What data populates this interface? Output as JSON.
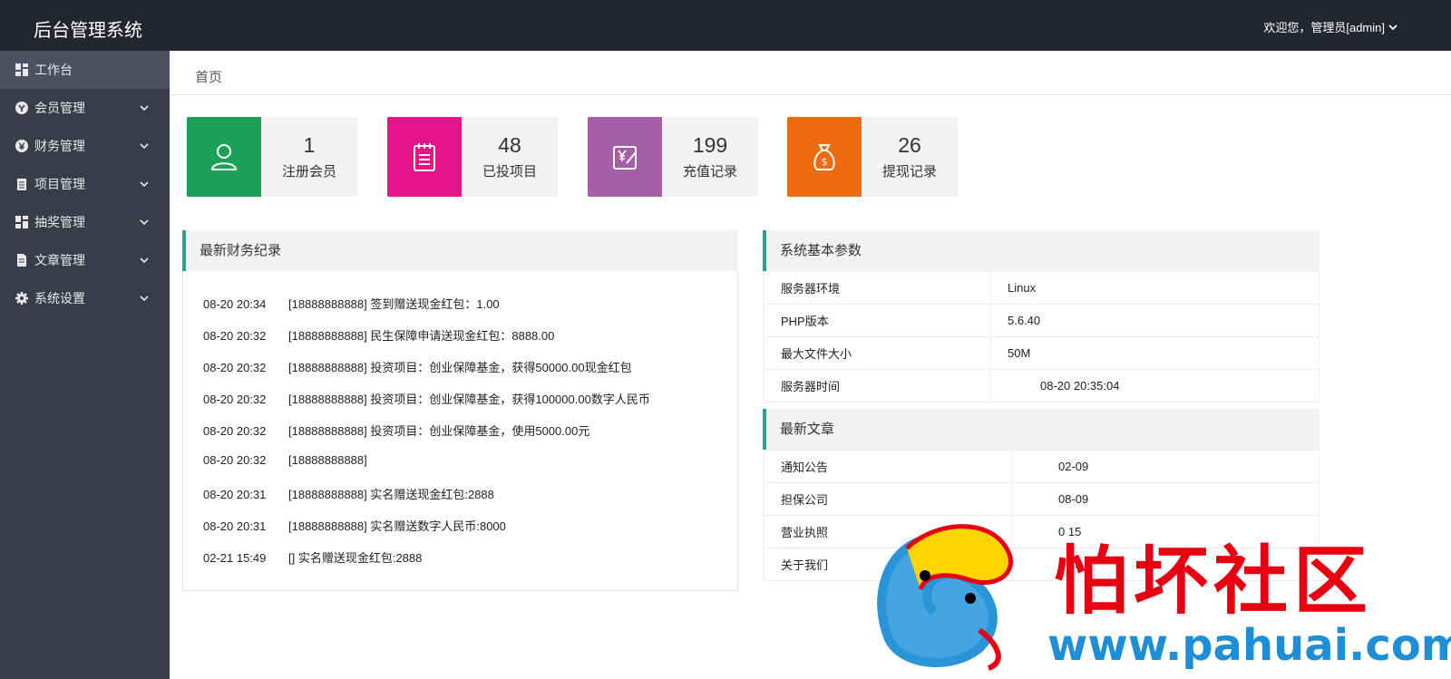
{
  "app": {
    "title": "后台管理系统"
  },
  "header": {
    "user_label": "欢迎您，管理员[admin]",
    "user_dropdown_icon": "chevron-down-icon"
  },
  "sidebar": {
    "items": [
      {
        "label": "工作台",
        "icon": "dashboard-icon",
        "active": true
      },
      {
        "label": "会员管理",
        "icon": "member-icon"
      },
      {
        "label": "财务管理",
        "icon": "yen-icon"
      },
      {
        "label": "项目管理",
        "icon": "clipboard-icon"
      },
      {
        "label": "抽奖管理",
        "icon": "grid-icon"
      },
      {
        "label": "文章管理",
        "icon": "document-icon"
      },
      {
        "label": "系统设置",
        "icon": "gear-icon"
      }
    ]
  },
  "breadcrumb": {
    "label": "首页"
  },
  "stats": [
    {
      "value": "1",
      "label": "注册会员",
      "color": "#1aa157",
      "icon": "user-icon"
    },
    {
      "value": "48",
      "label": "已投项目",
      "color": "#e4148a",
      "icon": "notepad-icon"
    },
    {
      "value": "199",
      "label": "充值记录",
      "color": "#a65ea6",
      "icon": "recharge-icon"
    },
    {
      "value": "26",
      "label": "提现记录",
      "color": "#ee6b10",
      "icon": "money-bag-icon"
    }
  ],
  "finance": {
    "title": "最新财务纪录",
    "records": [
      {
        "time": "08-20 20:34",
        "text": "[18888888888] 签到赠送现金红包：1.00"
      },
      {
        "time": "08-20 20:32",
        "text": "[18888888888] 民生保障申请送现金红包：8888.00"
      },
      {
        "time": "08-20 20:32",
        "text": "[18888888888] 投资项目：创业保障基金，获得50000.00现金红包"
      },
      {
        "time": "08-20 20:32",
        "text": "[18888888888] 投资项目：创业保障基金，获得100000.00数字人民币"
      },
      {
        "time": "08-20 20:32",
        "text": "[18888888888] 投资项目：创业保障基金，使用5000.00元"
      },
      {
        "time": "08-20 20:32",
        "text": "[18888888888]"
      },
      {
        "time": "08-20 20:31",
        "text": "[18888888888] 实名赠送现金红包:2888"
      },
      {
        "time": "08-20 20:31",
        "text": "[18888888888] 实名赠送数字人民币:8000"
      },
      {
        "time": "02-21 15:49",
        "text": "[] 实名赠送现金红包:2888"
      }
    ]
  },
  "system": {
    "title": "系统基本参数",
    "rows": [
      {
        "key": "服务器环境",
        "value": "Linux"
      },
      {
        "key": "PHP版本",
        "value": "5.6.40"
      },
      {
        "key": "最大文件大小",
        "value": "50M"
      },
      {
        "key": "服务器时间",
        "value": "08-20 20:35:04"
      }
    ]
  },
  "articles": {
    "title": "最新文章",
    "rows": [
      {
        "title": "通知公告",
        "date": "02-09"
      },
      {
        "title": "担保公司",
        "date": "08-09"
      },
      {
        "title": "营业执照",
        "date": "0  15"
      },
      {
        "title": "关于我们",
        "date": "1  19"
      }
    ]
  },
  "watermark": {
    "text": "怕坏社区",
    "url": "www.pahuai.com"
  }
}
